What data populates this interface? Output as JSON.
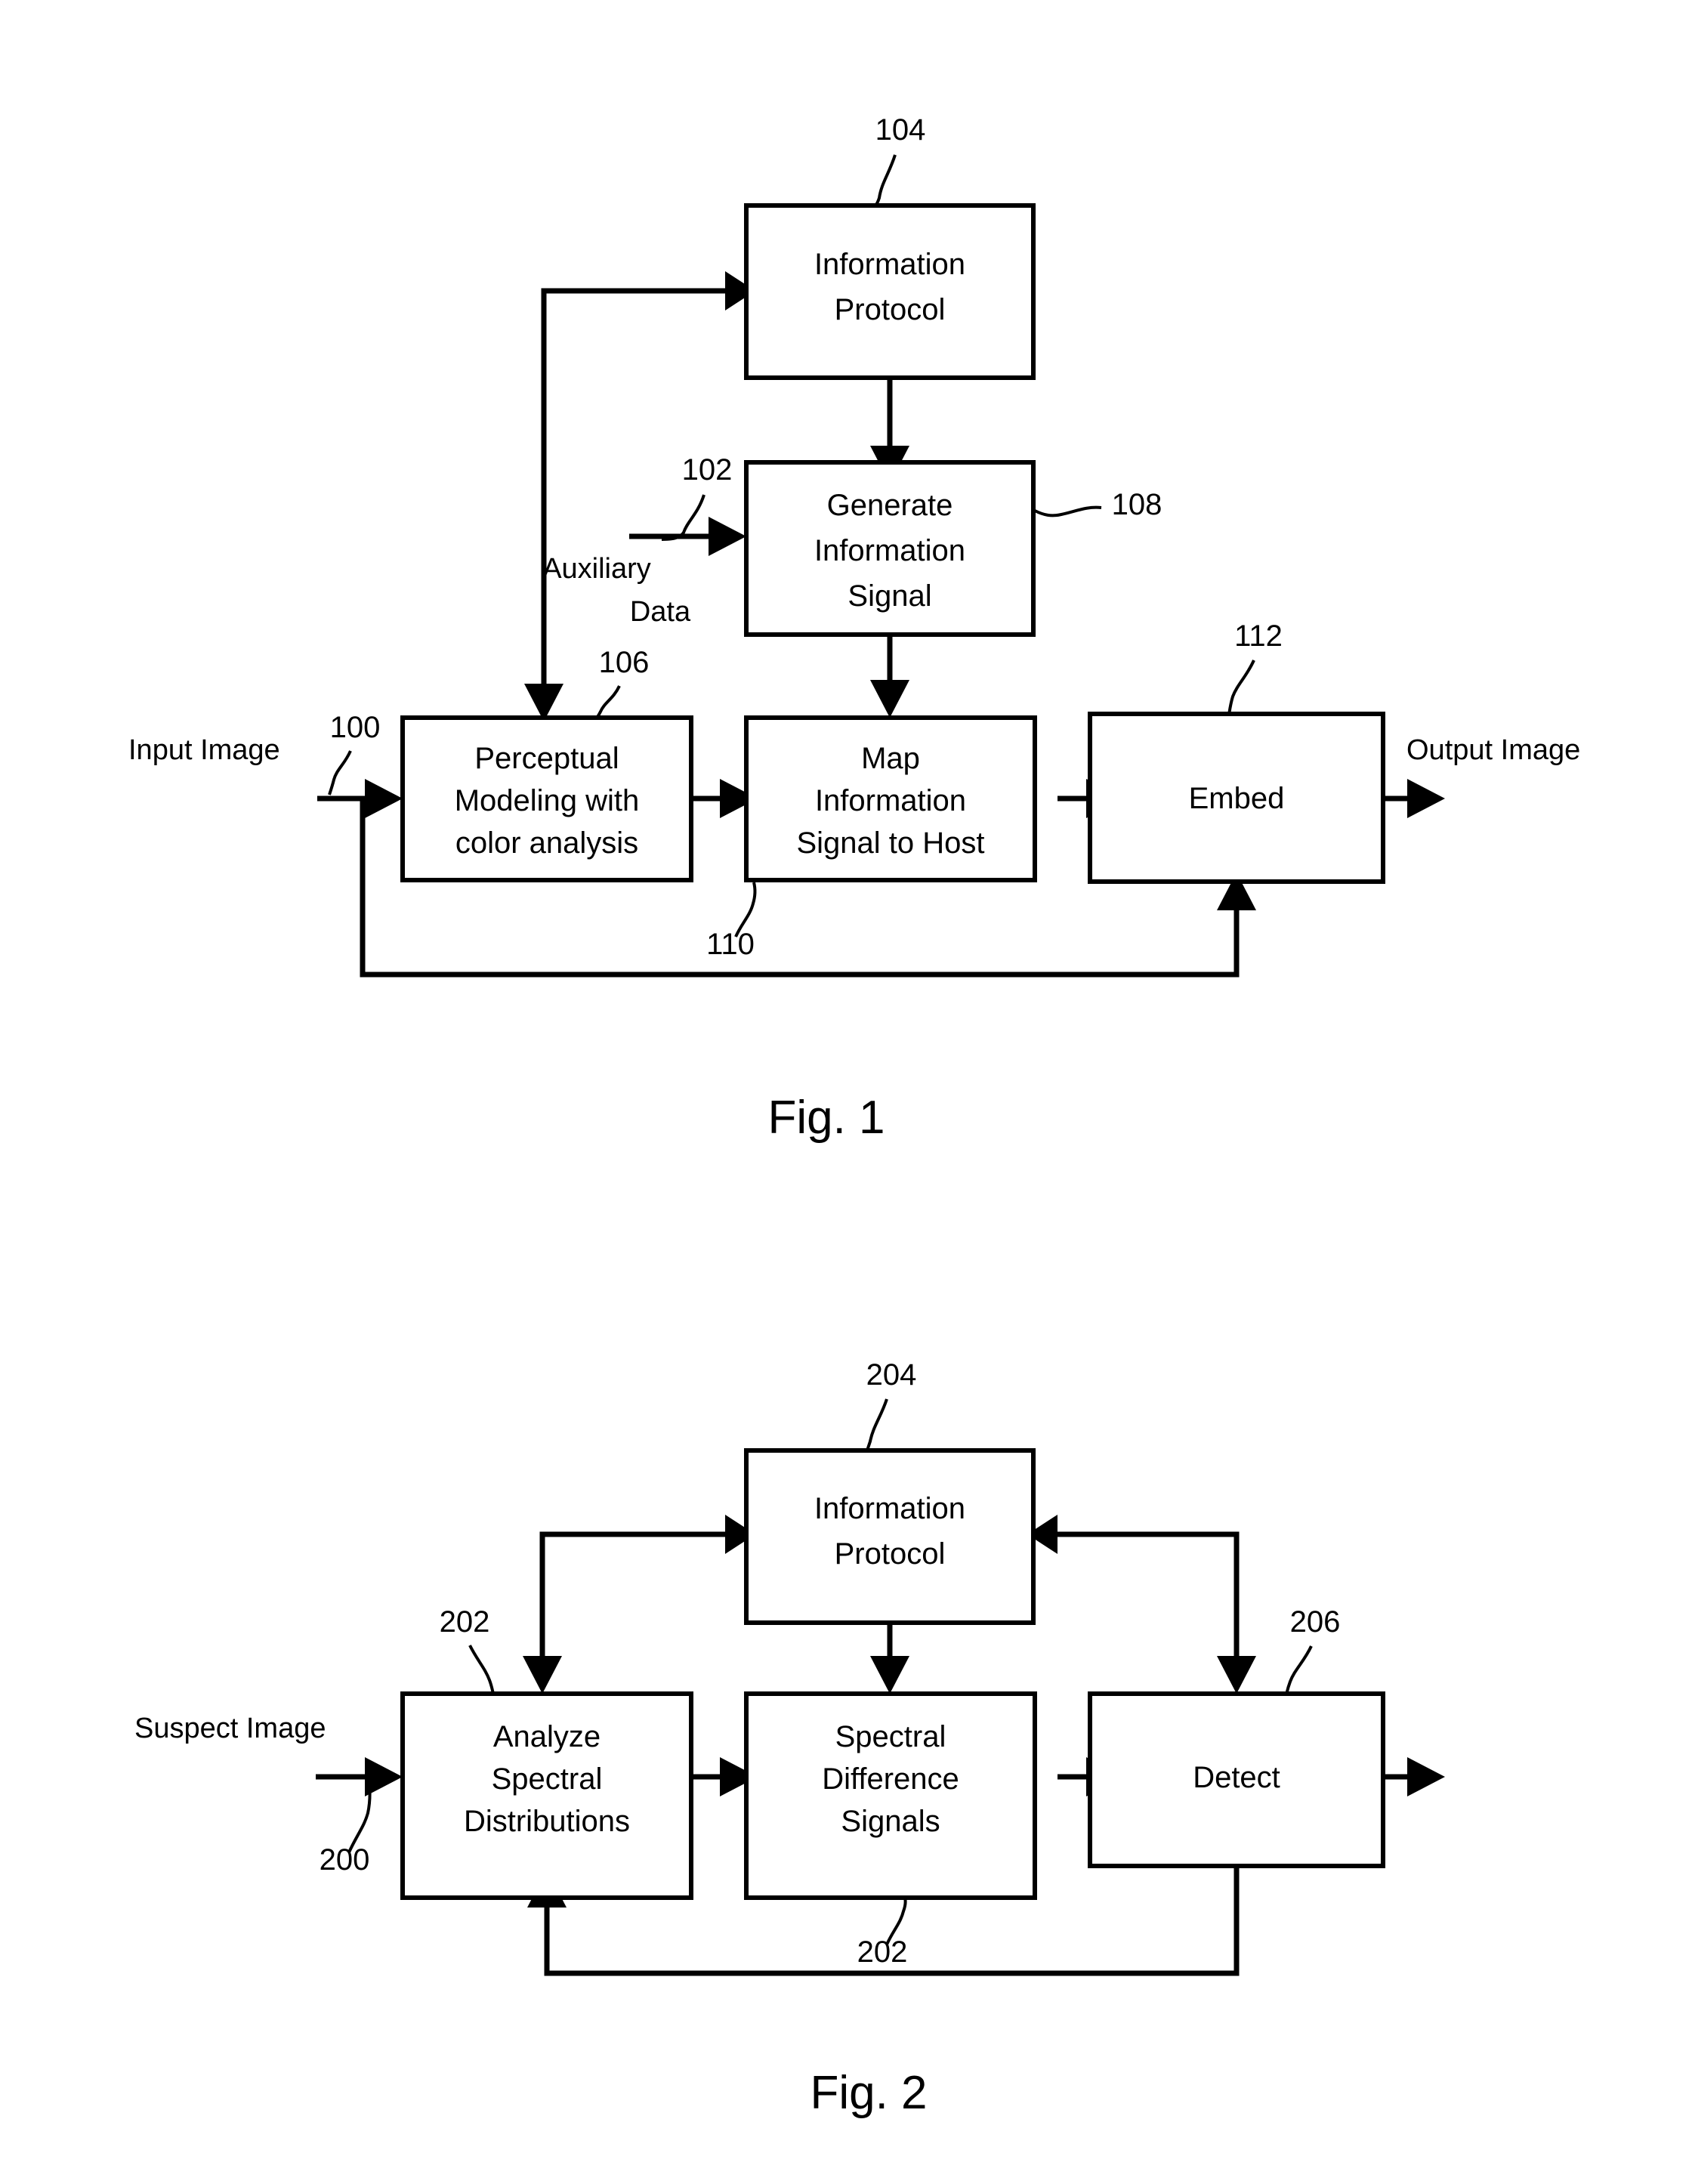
{
  "document": {
    "type": "patent-drawing-sheet",
    "figures": [
      {
        "id": "fig1",
        "caption": "Fig. 1",
        "nodes": [
          {
            "key": "information_protocol",
            "label_lines": [
              "Information",
              "Protocol"
            ],
            "ref": "104"
          },
          {
            "key": "generate_information_signal",
            "label_lines": [
              "Generate",
              "Information",
              "Signal"
            ],
            "ref": "108"
          },
          {
            "key": "perceptual_modeling",
            "label_lines": [
              "Perceptual",
              "Modeling with",
              "color analysis"
            ],
            "ref": "106"
          },
          {
            "key": "map_information_signal",
            "label_lines": [
              "Map",
              "Information",
              "Signal to Host"
            ],
            "ref": "110"
          },
          {
            "key": "embed",
            "label_lines": [
              "Embed"
            ],
            "ref": "112"
          }
        ],
        "io_labels": [
          {
            "key": "input_image",
            "text": "Input Image",
            "ref": "100"
          },
          {
            "key": "auxiliary_data",
            "text_lines": [
              "Auxiliary",
              "Data"
            ],
            "ref": "102"
          },
          {
            "key": "output_image",
            "text": "Output Image"
          }
        ],
        "refs": [
          "104",
          "102",
          "108",
          "106",
          "100",
          "110",
          "112"
        ]
      },
      {
        "id": "fig2",
        "caption": "Fig. 2",
        "nodes": [
          {
            "key": "information_protocol",
            "label_lines": [
              "Information",
              "Protocol"
            ],
            "ref": "204"
          },
          {
            "key": "analyze_spectral_distributions",
            "label_lines": [
              "Analyze",
              "Spectral",
              "Distributions"
            ],
            "ref": "202"
          },
          {
            "key": "spectral_difference_signals",
            "label_lines": [
              "Spectral",
              "Difference",
              "Signals"
            ],
            "ref": "202"
          },
          {
            "key": "detect",
            "label_lines": [
              "Detect"
            ],
            "ref": "206"
          }
        ],
        "io_labels": [
          {
            "key": "suspect_image",
            "text": "Suspect Image",
            "ref": "200"
          }
        ],
        "refs": [
          "204",
          "202",
          "206",
          "200",
          "202"
        ]
      }
    ]
  },
  "fig1": {
    "caption": "Fig. 1",
    "boxes": {
      "information_protocol": {
        "line1": "Information",
        "line2": "Protocol"
      },
      "generate_information_signal": {
        "line1": "Generate",
        "line2": "Information",
        "line3": "Signal"
      },
      "perceptual_modeling": {
        "line1": "Perceptual",
        "line2": "Modeling with",
        "line3": "color analysis"
      },
      "map_information_signal": {
        "line1": "Map",
        "line2": "Information",
        "line3": "Signal to Host"
      },
      "embed": {
        "line1": "Embed"
      }
    },
    "labels": {
      "input_image": "Input Image",
      "output_image": "Output Image",
      "auxiliary_data_line1": "Auxiliary",
      "auxiliary_data_line2": "Data"
    },
    "refs": {
      "r104": "104",
      "r102": "102",
      "r108": "108",
      "r106": "106",
      "r100": "100",
      "r110": "110",
      "r112": "112"
    }
  },
  "fig2": {
    "caption": "Fig. 2",
    "boxes": {
      "information_protocol": {
        "line1": "Information",
        "line2": "Protocol"
      },
      "analyze_spectral_distributions": {
        "line1": "Analyze",
        "line2": "Spectral",
        "line3": "Distributions"
      },
      "spectral_difference_signals": {
        "line1": "Spectral",
        "line2": "Difference",
        "line3": "Signals"
      },
      "detect": {
        "line1": "Detect"
      }
    },
    "labels": {
      "suspect_image": "Suspect Image"
    },
    "refs": {
      "r204": "204",
      "r202_left": "202",
      "r206": "206",
      "r200": "200",
      "r202_bottom": "202"
    }
  }
}
